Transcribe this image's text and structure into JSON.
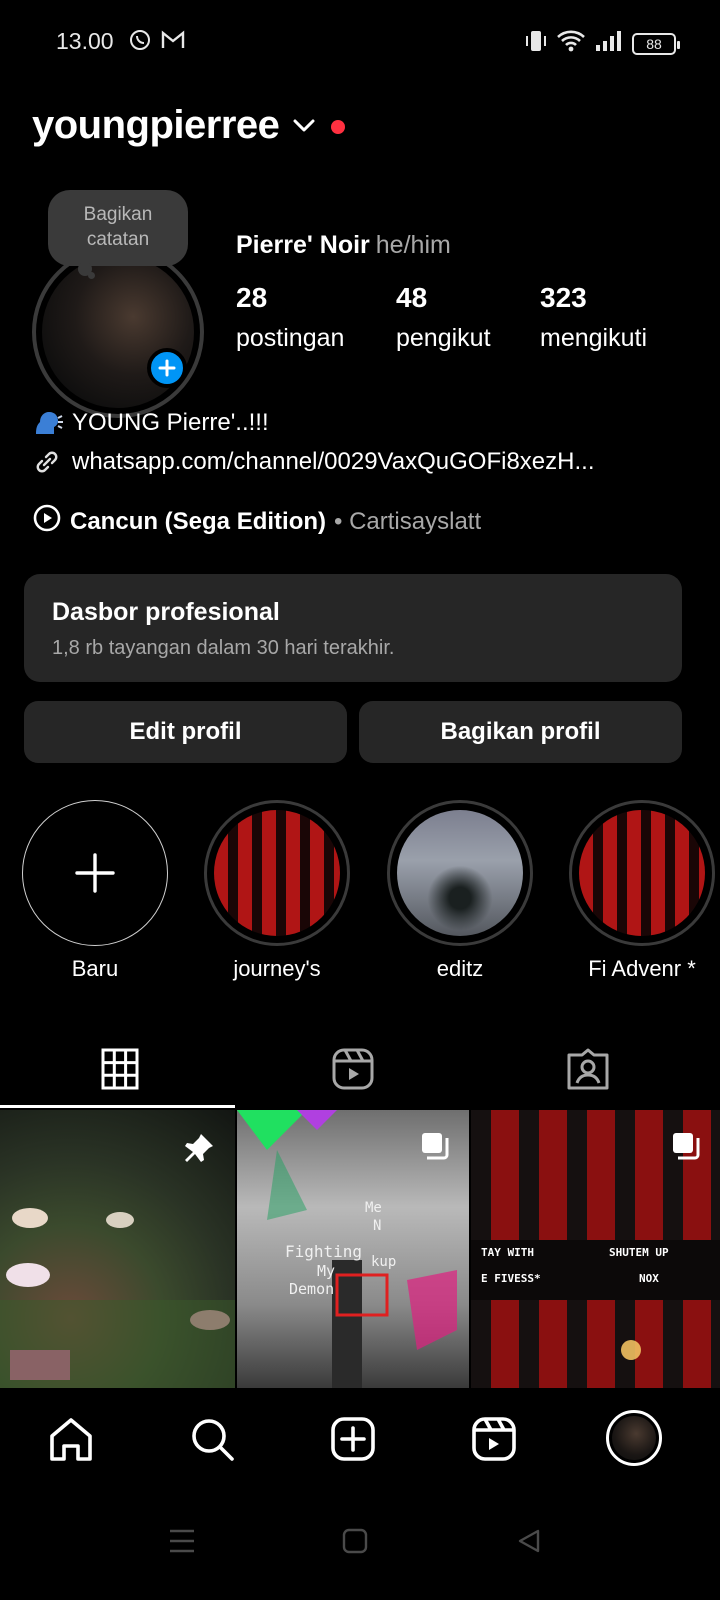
{
  "status_bar": {
    "time": "13.00",
    "battery": "88"
  },
  "header": {
    "username": "youngpierree"
  },
  "note": {
    "text_line1": "Bagikan",
    "text_line2": "catatan"
  },
  "profile": {
    "display_name": "Pierre' Noir",
    "pronouns": "he/him"
  },
  "stats": [
    {
      "value": "28",
      "label": "postingan"
    },
    {
      "value": "48",
      "label": "pengikut"
    },
    {
      "value": "323",
      "label": "mengikuti"
    }
  ],
  "bio": {
    "line1": "YOUNG Pierre'..!!!",
    "link": "whatsapp.com/channel/0029VaxQuGOFi8xezH..."
  },
  "music": {
    "title": "Cancun (Sega Edition)",
    "artist": "• Cartisayslatt"
  },
  "dashboard": {
    "title": "Dasbor profesional",
    "subtitle": "1,8 rb tayangan dalam 30 hari terakhir."
  },
  "buttons": {
    "edit": "Edit profil",
    "share": "Bagikan profil"
  },
  "highlights": [
    {
      "label": "Baru"
    },
    {
      "label": "journey's"
    },
    {
      "label": "editz"
    },
    {
      "label": "Fi Advenr *"
    }
  ],
  "tabs": [
    "grid-icon",
    "reels-icon",
    "tagged-icon"
  ],
  "posts": {
    "post2_lines": [
      "Me",
      "N",
      "Fighting",
      "My",
      "Demon",
      "kup"
    ],
    "post3_lines": [
      "TAY WITH",
      "SHUTEM UP",
      "E FIVESS*",
      "NOX"
    ]
  },
  "colors": {
    "accent": "#0095f6",
    "live_dot": "#ff3040",
    "card": "#262626"
  }
}
